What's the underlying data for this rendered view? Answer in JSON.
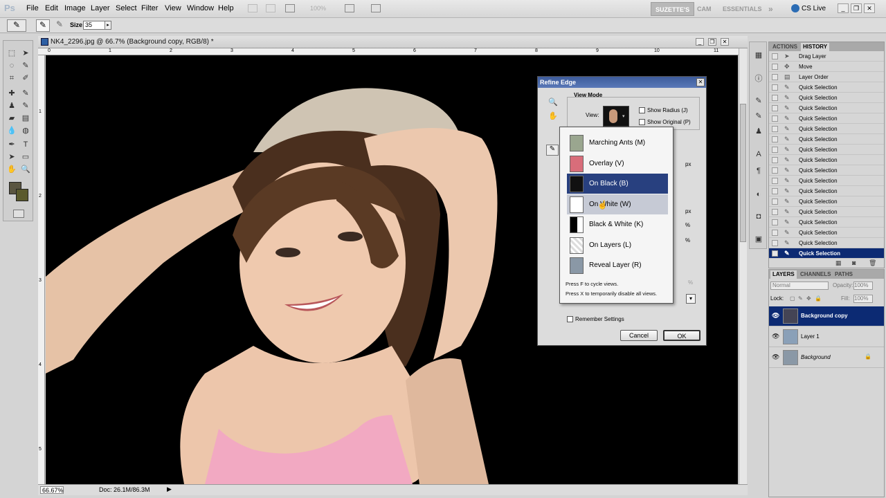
{
  "menubar": {
    "logo": "Ps",
    "items": [
      "File",
      "Edit",
      "Image",
      "Layer",
      "Select",
      "Filter",
      "View",
      "Window",
      "Help"
    ],
    "zoom": "100%",
    "workspaces": [
      "SUZETTE'S",
      "CAM",
      "ESSENTIALS"
    ],
    "more": "»",
    "cslive": "CS Live",
    "win_controls": [
      "_",
      "❐",
      "✕"
    ]
  },
  "options": {
    "size_label": "Size:",
    "size_value": "35"
  },
  "document": {
    "title": "NK4_2296.jpg @ 66.7% (Background copy, RGB/8) *",
    "zoom": "66.67%",
    "doc_info": "Doc: 26.1M/86.3M",
    "ruler_top": [
      "0",
      "1",
      "2",
      "3",
      "4",
      "5",
      "6",
      "7",
      "8",
      "9",
      "10",
      "11"
    ],
    "ruler_left": [
      "1",
      "2",
      "3",
      "4",
      "5"
    ]
  },
  "history": {
    "tabs": [
      "ACTIONS",
      "HISTORY"
    ],
    "items": [
      "Drag Layer",
      "Move",
      "Layer Order",
      "Quick Selection",
      "Quick Selection",
      "Quick Selection",
      "Quick Selection",
      "Quick Selection",
      "Quick Selection",
      "Quick Selection",
      "Quick Selection",
      "Quick Selection",
      "Quick Selection",
      "Quick Selection",
      "Quick Selection",
      "Quick Selection",
      "Quick Selection",
      "Quick Selection",
      "Quick Selection",
      "Quick Selection"
    ],
    "selected_index": 19
  },
  "layers": {
    "tabs": [
      "LAYERS",
      "CHANNELS",
      "PATHS"
    ],
    "blend_mode": "Normal",
    "opacity_label": "Opacity:",
    "opacity": "100%",
    "lock_label": "Lock:",
    "fill_label": "Fill:",
    "fill": "100%",
    "items": [
      "Background copy",
      "Layer 1",
      "Background"
    ],
    "selected_index": 0
  },
  "dialog": {
    "title": "Refine Edge",
    "view_mode_label": "View Mode",
    "view_label": "View:",
    "show_radius": "Show Radius (J)",
    "show_original": "Show Original (P)",
    "unit_px_1": "px",
    "unit_px_2": "px",
    "unit_pct_1": "%",
    "unit_pct_2": "%",
    "unit_pct_3": "%",
    "remember": "Remember Settings",
    "cancel": "Cancel",
    "ok": "OK"
  },
  "view_dropdown": {
    "items": [
      "Marching Ants (M)",
      "Overlay (V)",
      "On Black (B)",
      "On White (W)",
      "Black & White (K)",
      "On Layers (L)",
      "Reveal Layer (R)"
    ],
    "selected_index": 2,
    "hover_index": 3,
    "hint1": "Press F to cycle views.",
    "hint2": "Press X to temporarily disable all views."
  },
  "colors": {
    "selection": "#0c2a73",
    "dropdown_selected": "#28407f",
    "canvas_bg": "#000000",
    "top_shirt": "#f2a9c2"
  }
}
